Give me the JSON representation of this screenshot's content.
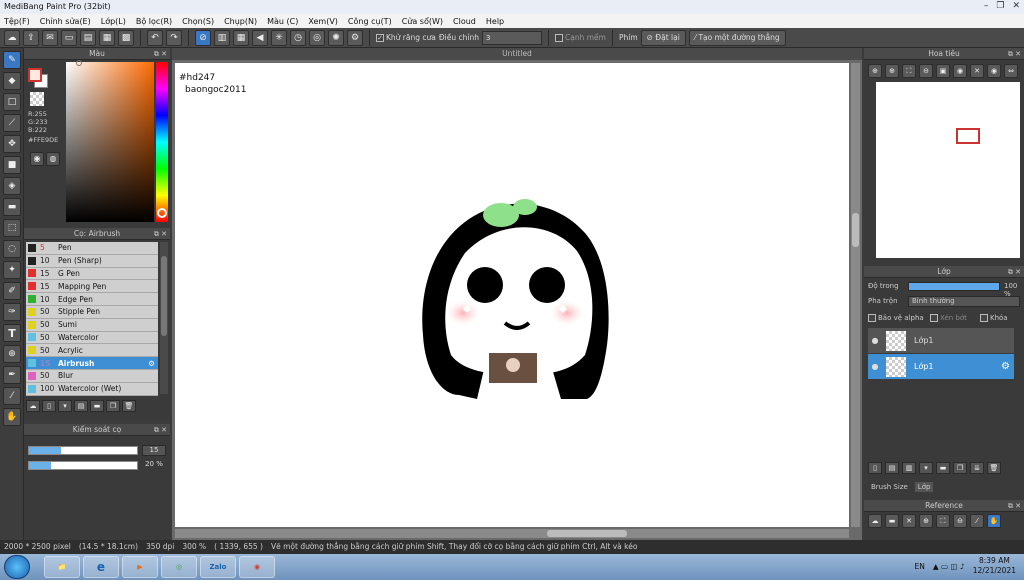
{
  "window": {
    "title": "MediBang Paint Pro (32bit)",
    "buttons": [
      "–",
      "❐",
      "✕"
    ]
  },
  "menu": [
    "Tệp(F)",
    "Chỉnh sửa(E)",
    "Lớp(L)",
    "Bộ lọc(R)",
    "Chọn(S)",
    "Chụp(N)",
    "Màu (C)",
    "Xem(V)",
    "Công cụ(T)",
    "Cửa sổ(W)",
    "Cloud",
    "Help"
  ],
  "toolbar": {
    "antialias_label": "Khử răng cưa",
    "adjust_label": "Điều chỉnh",
    "adjust_value": "3",
    "crisp_label": "Cạnh mềm",
    "key_label": "Phím",
    "reset_label": "Đặt lại",
    "line_label": "Tạo một đường thẳng"
  },
  "color_panel": {
    "title": "Màu",
    "rgb": [
      "R:255",
      "G:233",
      "B:222"
    ],
    "hex": "#FFE9DE",
    "fg_color": "#ffe9de"
  },
  "brush_panel": {
    "title": "Cọ: Airbrush",
    "brushes": [
      {
        "size": "5",
        "name": "Pen",
        "color": "#222222",
        "red": true
      },
      {
        "size": "10",
        "name": "Pen (Sharp)",
        "color": "#222222",
        "red": false
      },
      {
        "size": "15",
        "name": "G Pen",
        "color": "#e03030",
        "red": false
      },
      {
        "size": "15",
        "name": "Mapping Pen",
        "color": "#e03030",
        "red": false
      },
      {
        "size": "10",
        "name": "Edge Pen",
        "color": "#30b030",
        "red": false
      },
      {
        "size": "50",
        "name": "Stipple Pen",
        "color": "#e0d020",
        "red": false
      },
      {
        "size": "50",
        "name": "Sumi",
        "color": "#e0d020",
        "red": false
      },
      {
        "size": "50",
        "name": "Watercolor",
        "color": "#60c0e0",
        "red": false
      },
      {
        "size": "50",
        "name": "Acrylic",
        "color": "#e0d020",
        "red": false
      },
      {
        "size": "15",
        "name": "Airbrush",
        "color": "#60c0e0",
        "red": false,
        "selected": true
      },
      {
        "size": "50",
        "name": "Blur",
        "color": "#e060c0",
        "red": false
      },
      {
        "size": "100",
        "name": "Watercolor (Wet)",
        "color": "#60c0e0",
        "red": false
      }
    ]
  },
  "brush_control": {
    "title": "Kiểm soát cọ",
    "size_value": "15",
    "size_fraction": 0.3,
    "opacity_value": "20 %",
    "opacity_fraction": 0.2
  },
  "canvas": {
    "tab_title": "Untitled",
    "text_line1": "#hd247",
    "text_line2": "baongoc2011"
  },
  "navigator": {
    "title": "Hoa tiêu"
  },
  "layers": {
    "title": "Lớp",
    "opacity_label": "Độ trong",
    "opacity_value": "100 %",
    "blend_label": "Pha trộn",
    "blend_value": "Bình thường",
    "protect_alpha": "Bảo vệ alpha",
    "clipping": "Xén bớt",
    "lock": "Khóa",
    "items": [
      {
        "name": "Lớp1",
        "selected": false
      },
      {
        "name": "Lớp1",
        "selected": true
      }
    ],
    "tab_brushsize": "Brush Size",
    "tab_layer": "Lớp"
  },
  "reference": {
    "title": "Reference"
  },
  "status": {
    "size": "2000 * 2500 pixel",
    "cm": "(14.5 * 18.1cm)",
    "dpi": "350 dpi",
    "zoom": "300 %",
    "coords": "( 1339, 655 )",
    "hint": "Vẽ một đường thẳng bằng cách giữ phím Shift, Thay đổi cỡ cọ bằng cách giữ phím Ctrl, Alt và kéo"
  },
  "taskbar": {
    "apps": [
      "📁",
      "e",
      "▶",
      "◎",
      "Zalo",
      "◉"
    ],
    "lang": "EN",
    "time": "8:39 AM",
    "date": "12/21/2021"
  }
}
